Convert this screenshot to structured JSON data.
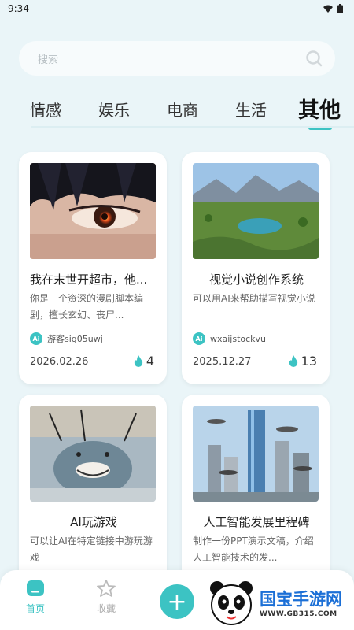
{
  "status_bar": {
    "time": "9:34"
  },
  "search": {
    "placeholder": "搜索"
  },
  "tabs": [
    {
      "label": "情感"
    },
    {
      "label": "娱乐"
    },
    {
      "label": "电商"
    },
    {
      "label": "生活"
    },
    {
      "label": "其他",
      "active": true
    }
  ],
  "cards": [
    {
      "title": "我在末世开超市，他...",
      "desc": "你是一个资深的漫剧脚本编剧，擅长玄幻、丧尸...",
      "author": "游客sig05uwj",
      "date": "2026.02.26",
      "hot": "4"
    },
    {
      "title": "视觉小说创作系统",
      "desc": "可以用AI来帮助描写视觉小说",
      "author": "wxaijstockvu",
      "date": "2025.12.27",
      "hot": "13"
    },
    {
      "title": "AI玩游戏",
      "desc": "可以让AI在特定链接中游玩游戏"
    },
    {
      "title": "人工智能发展里程碑",
      "desc": "制作一份PPT演示文稿，介绍人工智能技术的发..."
    }
  ],
  "badges": {
    "ai": "Ai"
  },
  "bottom_nav": {
    "home": "首页",
    "favorites": "收藏",
    "add": "+"
  },
  "watermark": {
    "main": "国宝手游网",
    "sub": "WWW.GB315.COM"
  },
  "colors": {
    "accent": "#3cc3c3",
    "background": "#eaf5f8"
  }
}
